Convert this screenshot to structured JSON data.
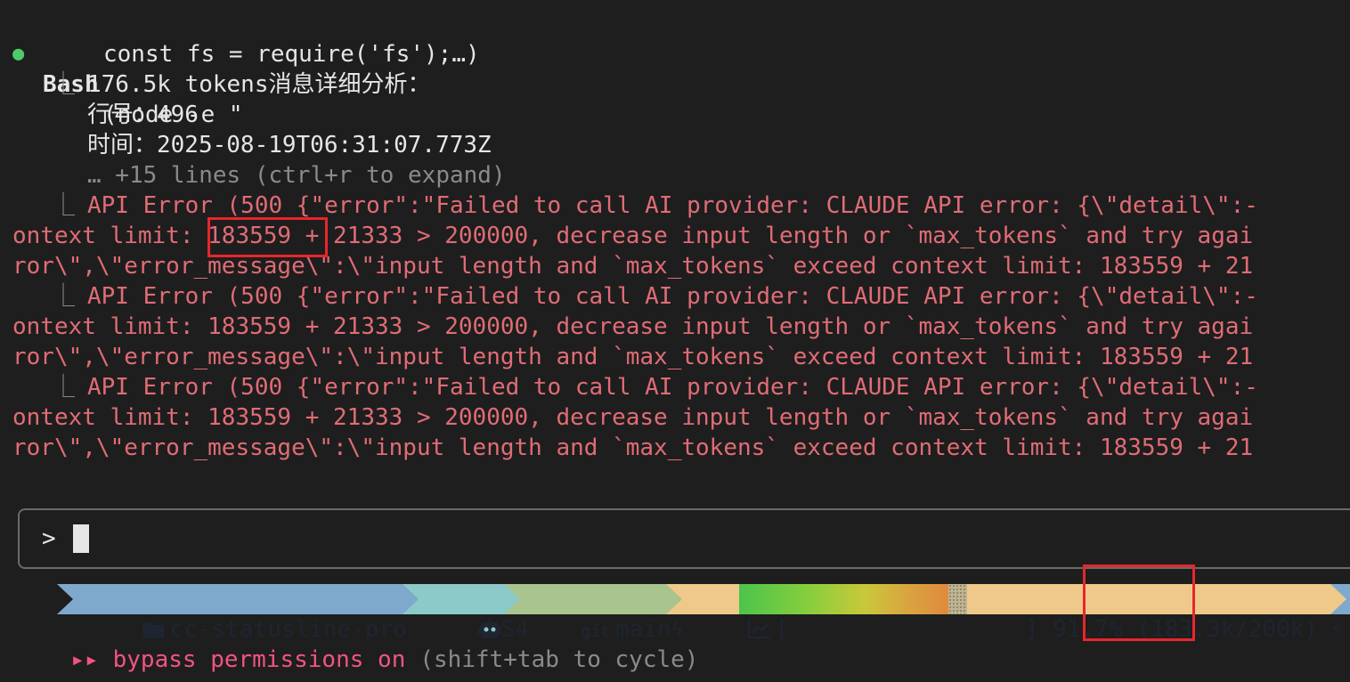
{
  "bash": {
    "tool": "Bash",
    "args_line1": "(node -e \"",
    "args_line2": "const fs = require('fs');…)"
  },
  "output": {
    "result_line1": "176.5k tokens消息详细分析：",
    "result_line2": "行号：496",
    "result_line3": "时间：2025-08-19T06:31:07.773Z",
    "result_more": "… +15 lines (ctrl+r to expand)"
  },
  "errors": [
    {
      "line1": "API Error (500 {\"error\":\"Failed to call AI provider: CLAUDE API error: {\\\"detail\\\":-",
      "line2_prefix": "ontext limit: ",
      "line2_highlight": "183559",
      "line2_suffix": " + 21333 > 200000, decrease input length or `max_tokens` and try agai",
      "line3": "ror\\\",\\\"error_message\\\":\\\"input length and `max_tokens` exceed context limit: 183559 + 21"
    },
    {
      "line1": "API Error (500 {\"error\":\"Failed to call AI provider: CLAUDE API error: {\\\"detail\\\":-",
      "line2": "ontext limit: 183559 + 21333 > 200000, decrease input length or `max_tokens` and try agai",
      "line3": "ror\\\",\\\"error_message\\\":\\\"input length and `max_tokens` exceed context limit: 183559 + 21"
    },
    {
      "line1": "API Error (500 {\"error\":\"Failed to call AI provider: CLAUDE API error: {\\\"detail\\\":-",
      "line2": "ontext limit: 183559 + 21333 > 200000, decrease input length or `max_tokens` and try agai",
      "line3": "ror\\\",\\\"error_message\\\":\\\"input length and `max_tokens` exceed context limit: 183559 + 21"
    }
  ],
  "input": {
    "prompt": ">"
  },
  "statusline": {
    "project": "cc-statusline-pro",
    "model": "S4",
    "git_label": "git",
    "branch": "main",
    "bar_open": "[",
    "bar_close": "]",
    "usage_fraction": 0.917,
    "percent": "91.7%",
    "tokens_open": "(",
    "tokens_highlight": "183.3k",
    "tokens_rest": "/200k)",
    "colors": {
      "project_bg": "#7fa9cc",
      "model_bg": "#8cc9c9",
      "git_bg": "#a9c48e",
      "context_bg": "#efc98a"
    }
  },
  "mode": {
    "marker": "▸▸",
    "text": "bypass permissions on",
    "hint": "(shift+tab to cycle)"
  }
}
